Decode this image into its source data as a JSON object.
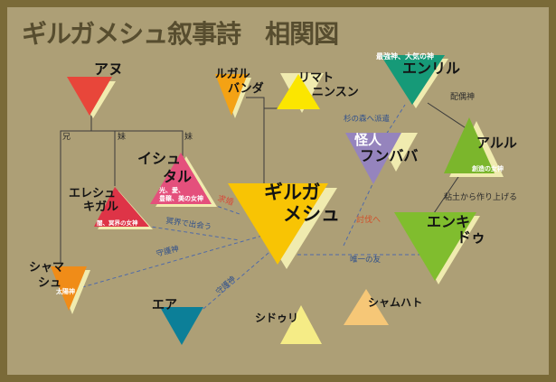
{
  "title": "ギルガメシュ叙事詩　相関図",
  "colors": {
    "frame": "#7a6a38",
    "background": "#ad9f76",
    "title": "#574d2f",
    "link": "#4f6aa8",
    "label": "#3a5590"
  },
  "characters": {
    "anu": {
      "name": "アヌ",
      "color": "#e8463a"
    },
    "lugalbanda": {
      "name_line1": "ルガル",
      "name_line2": "バンダ",
      "color": "#f4a214"
    },
    "rimat_ninsun": {
      "name_line1": "リマト",
      "name_line2": "ニンスン",
      "color": "#fbe600"
    },
    "enlil": {
      "name": "エンリル",
      "epithet": "最強神、大気の神",
      "color": "#169a78"
    },
    "gilgamesh": {
      "name_line1": "ギルガ",
      "name_line2": "メシュ",
      "color": "#f8c404"
    },
    "ishtar": {
      "name_line1": "イシュ",
      "name_line2": "タル",
      "epithet_line1": "光、愛、",
      "epithet_line2": "豊穣、美の女神",
      "color": "#e4507c"
    },
    "ereshkigal": {
      "name_line1": "エレシュ",
      "name_line2": "キガル",
      "epithet": "闇、冥界の女神",
      "color": "#de3447"
    },
    "humbaba": {
      "name_line1": "怪人",
      "name_line2": "フンババ",
      "color": "#9584bd"
    },
    "aruru": {
      "name": "アルル",
      "epithet": "創造の女神",
      "color": "#7bb62c"
    },
    "enkidu": {
      "name_line1": "エンキ",
      "name_line2": "ドゥ",
      "color": "#80bd2e"
    },
    "shamash": {
      "name_line1": "シャマ",
      "name_line2": "シュ",
      "epithet": "太陽神",
      "color": "#f08c18"
    },
    "ea": {
      "name": "エア",
      "color": "#0c7f98"
    },
    "siduri": {
      "name": "シドゥリ",
      "color": "#f5ec86"
    },
    "shamhat": {
      "name": "シャムハト",
      "color": "#f6c777"
    }
  },
  "family_labels": {
    "elder_brother": "兄",
    "younger_sister_1": "妹",
    "younger_sister_2": "妹"
  },
  "relations": {
    "courtship": "求婚",
    "meet_underworld": "冥界で出会う",
    "cedar_forest": "杉の森へ派遣",
    "subjugation": "討伐へ",
    "consort": "配偶神",
    "clay": "粘土から作り上げる",
    "only_friend": "唯一の友",
    "guardian_shamash": "守護神",
    "guardian_ea": "守護神"
  }
}
